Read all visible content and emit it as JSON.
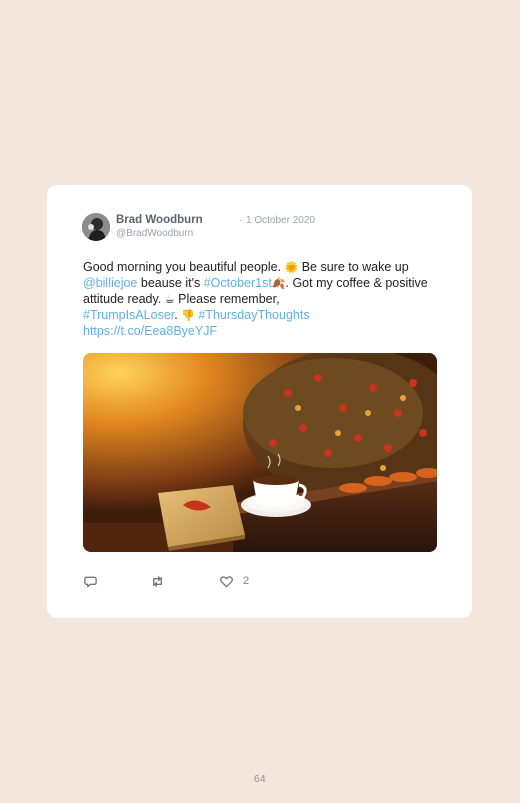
{
  "tweet": {
    "author_name": "Brad Woodburn",
    "separator": "·",
    "date": "1 October 2020",
    "handle": "@BradWoodburn",
    "text": {
      "t1": "Good morning you beautiful people. ",
      "e1": "🌞",
      "t2": " Be sure to wake up ",
      "mention": "@billiejoe",
      "t3": " beause it's ",
      "hashtag1": "#October1st",
      "e2": "🍂",
      "t4": ". Got my coffee & positive attitude ready. ",
      "e3": "☕",
      "t5": " Please remember, ",
      "hashtag2": "#TrumpIsALoser",
      "t6": ". ",
      "e4": "👎",
      "t7": " ",
      "hashtag3": "#ThursdayThoughts",
      "url": "https://t.co/Eea8ByeYJF"
    },
    "media_icon": "autumn-coffee-book-photo",
    "actions": {
      "reply_icon": "reply-icon",
      "retweet_icon": "retweet-icon",
      "like_icon": "heart-icon",
      "like_count": "2"
    }
  },
  "page": {
    "number": "64"
  },
  "colors": {
    "background": "#f3e7dd",
    "link": "#5fb0e8",
    "card": "#ffffff"
  }
}
